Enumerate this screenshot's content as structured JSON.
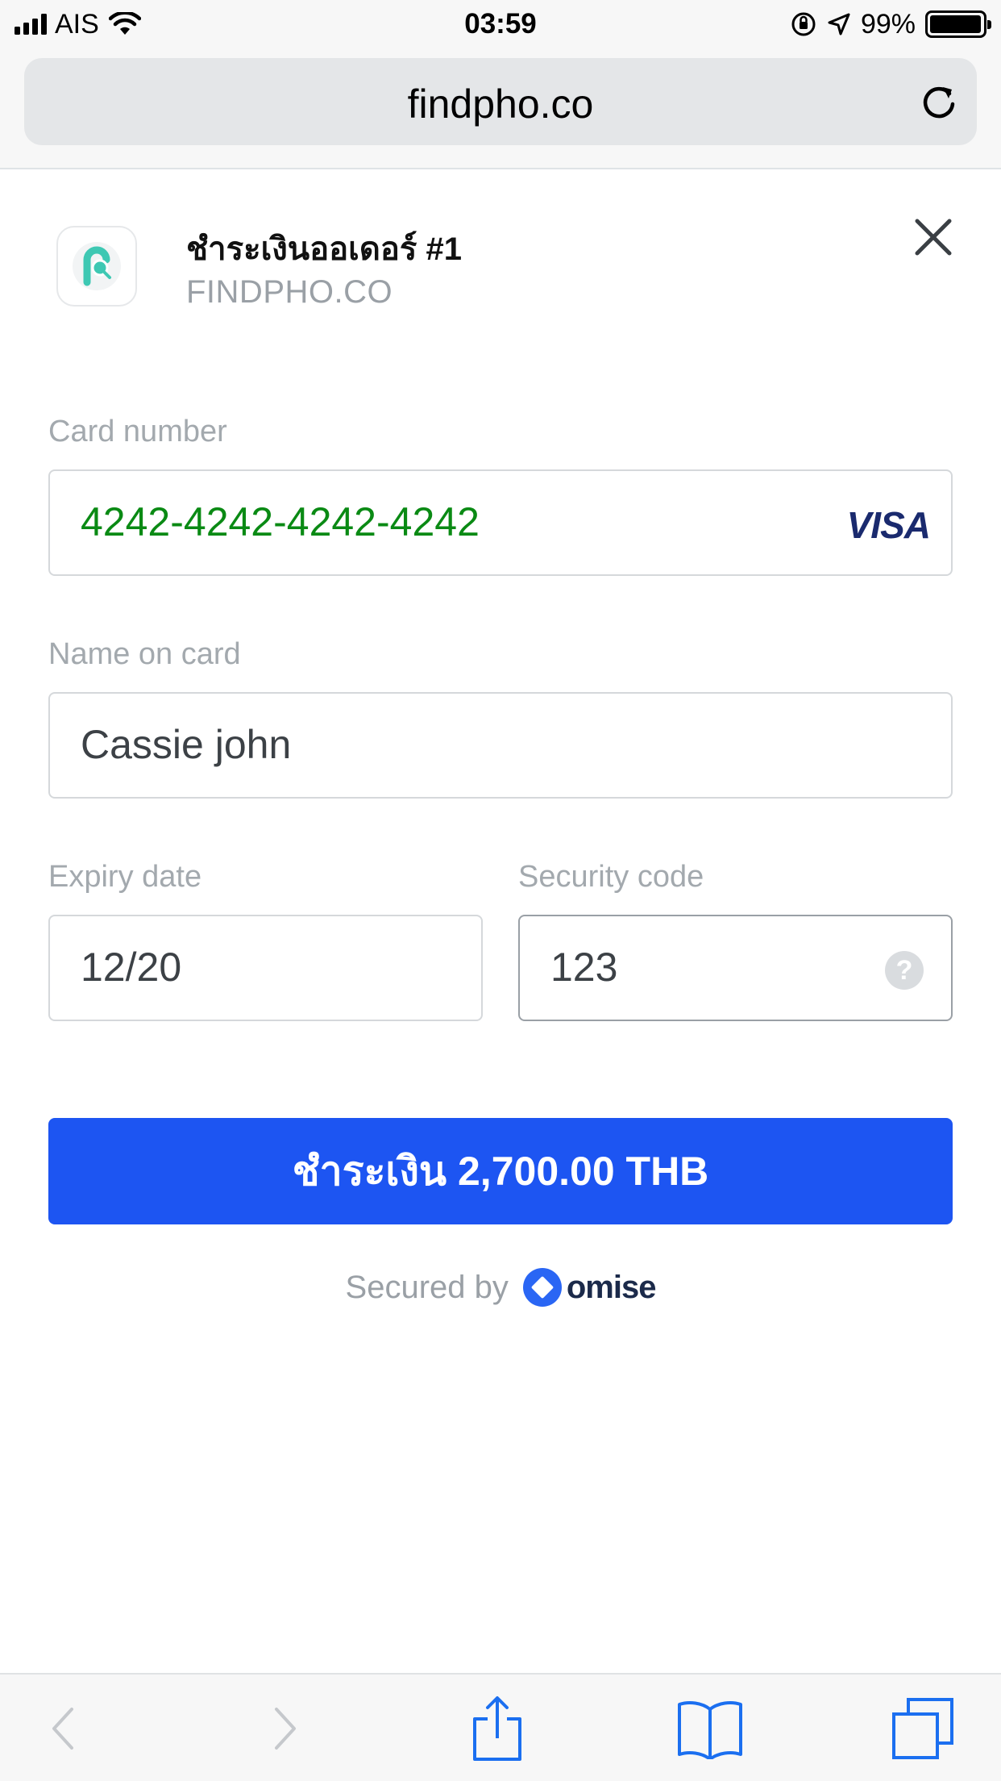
{
  "status_bar": {
    "carrier": "AIS",
    "time": "03:59",
    "battery_percent": "99%",
    "battery_level": 0.99
  },
  "browser": {
    "url": "findpho.co",
    "reload_icon": "reload-icon"
  },
  "header": {
    "title": "ชำระเงินออเดอร์ #1",
    "merchant": "FINDPHO.CO",
    "logo_icon": "findpho-logo-icon",
    "close_icon": "close-icon"
  },
  "form": {
    "card_number": {
      "label": "Card number",
      "value": "4242-4242-4242-4242",
      "brand": "VISA"
    },
    "name": {
      "label": "Name on card",
      "value": "Cassie john"
    },
    "expiry": {
      "label": "Expiry date",
      "value": "12/20"
    },
    "cvc": {
      "label": "Security code",
      "value": "123",
      "help": "?"
    }
  },
  "pay_button": {
    "label": "ชำระเงิน 2,700.00 THB"
  },
  "footer": {
    "secured_label": "Secured by",
    "brand": "omise"
  },
  "toolbar": {
    "icons": [
      "back-icon",
      "forward-icon",
      "share-icon",
      "bookmarks-icon",
      "tabs-icon"
    ]
  },
  "colors": {
    "accent": "#1d55f2",
    "card_number_text": "#0a8a14",
    "label_gray": "#a3a9ae",
    "visa_navy": "#1a2a6e",
    "omise_blue": "#2a66f4"
  }
}
